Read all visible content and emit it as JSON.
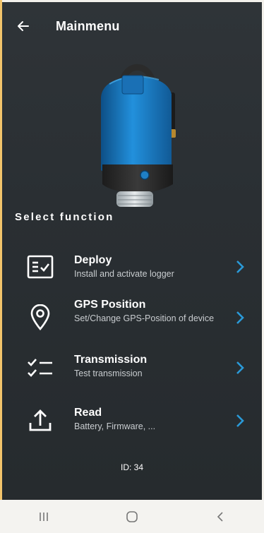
{
  "header": {
    "title": "Mainmenu"
  },
  "section_label": "Select function",
  "menu": [
    {
      "title": "Deploy",
      "subtitle": "Install and activate logger",
      "icon": "checklist-form-icon"
    },
    {
      "title": "GPS Position",
      "subtitle": "Set/Change GPS-Position of device",
      "icon": "location-pin-icon"
    },
    {
      "title": "Transmission",
      "subtitle": "Test transmission",
      "icon": "check-list-icon"
    },
    {
      "title": "Read",
      "subtitle": "Battery, Firmware, ...",
      "icon": "upload-icon"
    }
  ],
  "device_id": "ID: 34",
  "colors": {
    "accent": "#2a9ad8",
    "background": "#2b3034",
    "nav_bar": "#f4f3f0",
    "device_blue": "#1f7fc6"
  }
}
